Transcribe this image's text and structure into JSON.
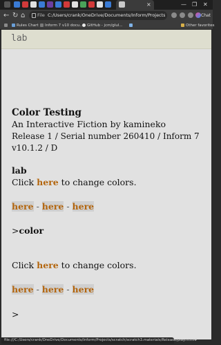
{
  "browser": {
    "tab_close": "×",
    "window_controls": {
      "minimize": "—",
      "maximize": "❐",
      "close": "✕"
    },
    "address": {
      "scheme_label": "File",
      "url": "C:/Users/crank/OneDrive/Documents/Inform/Projects/scratch/scra..."
    },
    "profile_label": "Chat",
    "bookmarks": [
      {
        "label": "Rules Chart",
        "color": "#6a9fd8"
      },
      {
        "label": "Inform 7 v10 docu...",
        "color": "#7a7a7a"
      },
      {
        "label": "GitHub - jcm/glul...",
        "color": "#e8e8e8"
      },
      {
        "label": "",
        "color": "#7fb3e8"
      }
    ],
    "other_favorites": "Other favorites",
    "status_url": "file:///C:/Users/crank/OneDrive/Documents/Inform/Projects/scratch/scratch3.materials/Release/play.html#"
  },
  "statusline": {
    "room": "lab"
  },
  "story": {
    "title": "Color Testing",
    "byline": "An Interactive Fiction by kamineko",
    "release_line1": "Release 1 / Serial number 260410 / Inform 7",
    "release_line2": "v10.1.2 / D",
    "room_heading": "lab",
    "click_prefix": "Click ",
    "link_word": "here",
    "click_suffix": " to change colors.",
    "sep": " - ",
    "prompt": ">",
    "command": "color",
    "prompt_empty": ">"
  }
}
